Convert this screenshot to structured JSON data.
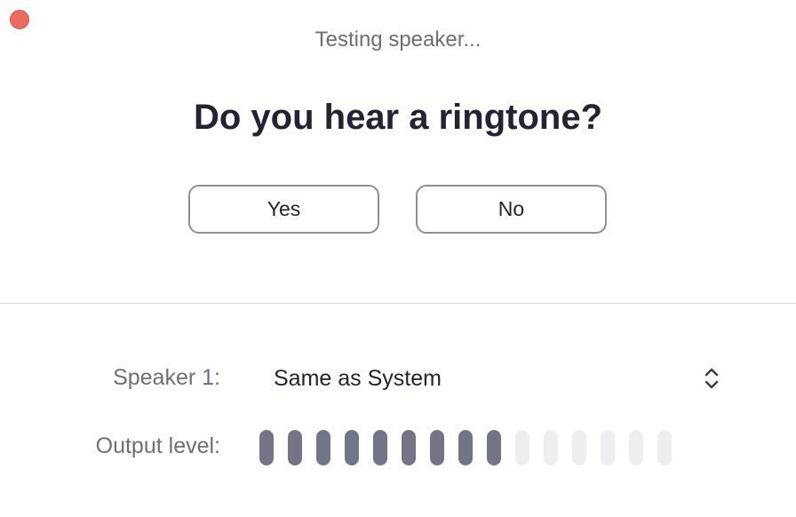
{
  "window": {
    "close_icon": "close-icon",
    "close_color": "#ec6a5e"
  },
  "status_text": "Testing speaker...",
  "question": "Do you hear a ringtone?",
  "buttons": {
    "yes_label": "Yes",
    "no_label": "No"
  },
  "speaker": {
    "label": "Speaker 1:",
    "selected": "Same as System",
    "chevron_icon": "up-down-chevron-icon"
  },
  "output": {
    "label": "Output level:",
    "total_bars": 15,
    "active_bars": 9,
    "active_color": "#747487",
    "inactive_color": "#eeeef0"
  }
}
